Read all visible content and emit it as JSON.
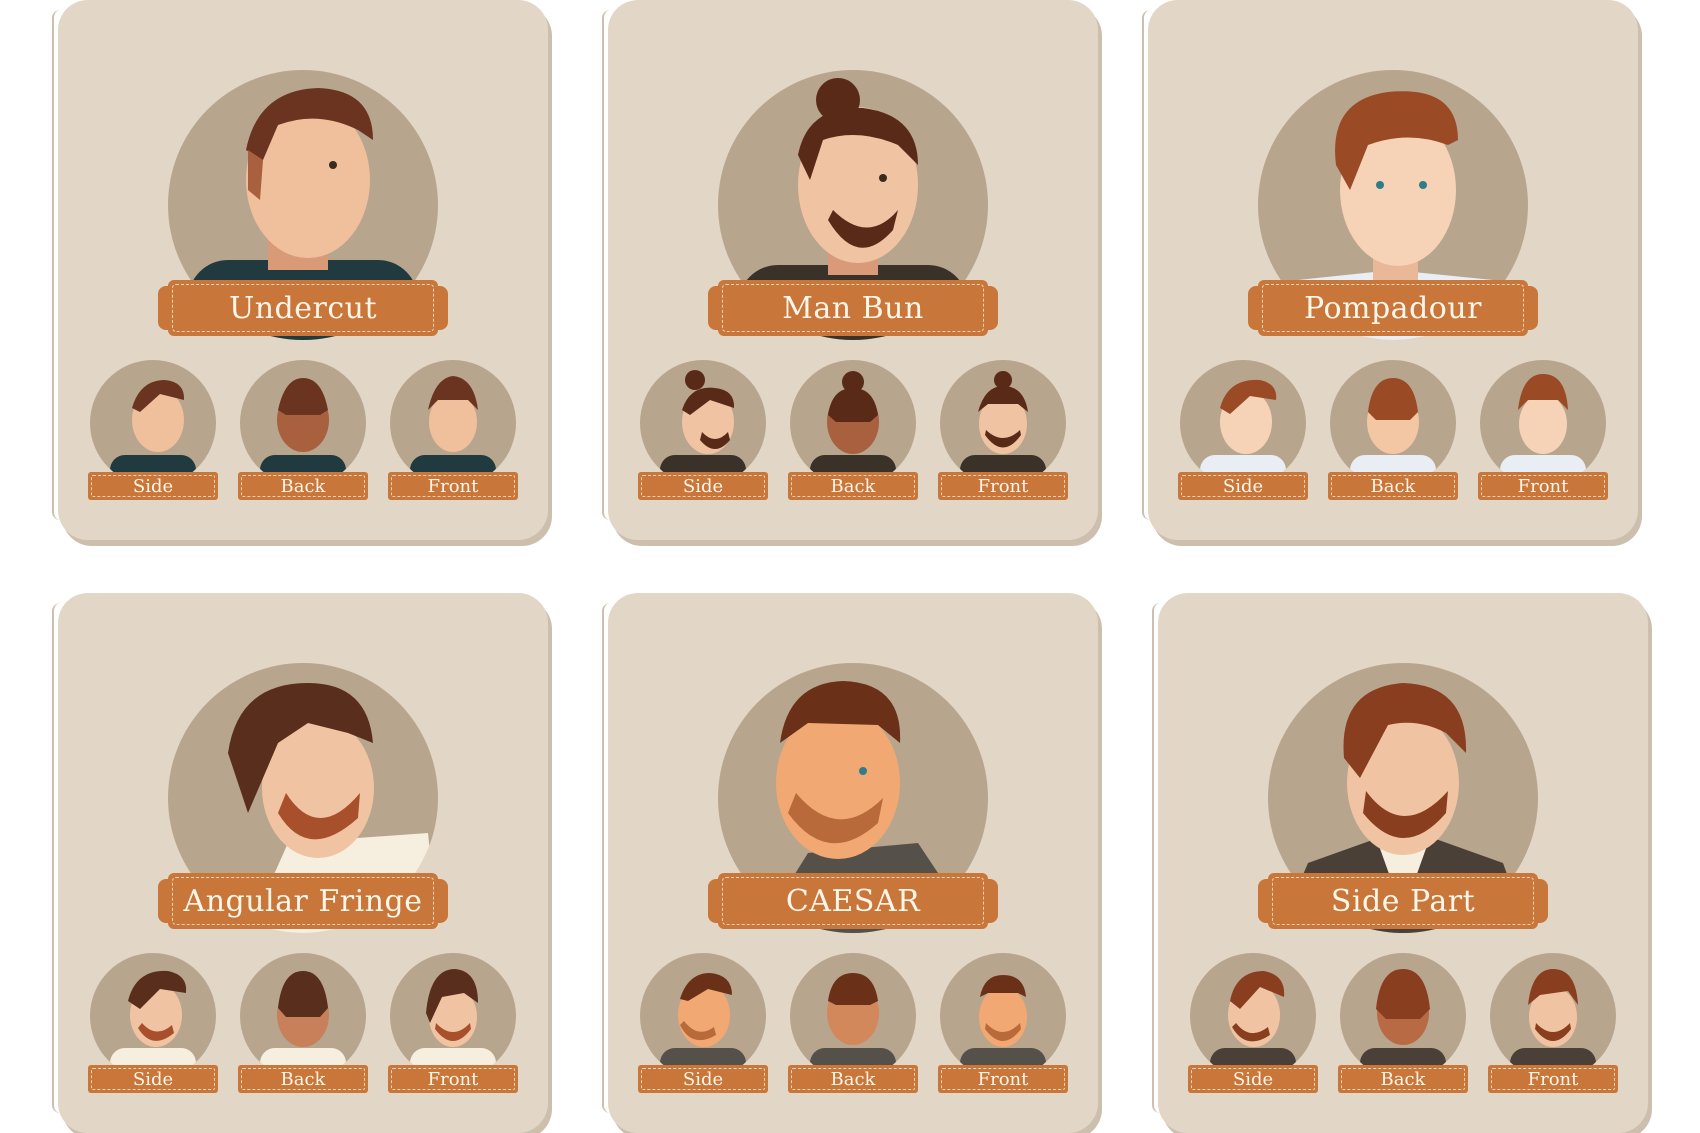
{
  "palette": {
    "card": "#e2d6c6",
    "circle": "#b8a58e",
    "banner": "#c87639",
    "banner_text": "#fff6ea"
  },
  "cards": [
    {
      "title": "Undercut",
      "views": [
        "Side",
        "Back",
        "Front"
      ],
      "hair": "#6a3420",
      "shirt": "#203a3f",
      "skin": "#f0bf9c"
    },
    {
      "title": "Man Bun",
      "views": [
        "Side",
        "Back",
        "Front"
      ],
      "hair": "#5a2a18",
      "shirt": "#3a3128",
      "skin": "#f0c4a2"
    },
    {
      "title": "Pompadour",
      "views": [
        "Side",
        "Back",
        "Front"
      ],
      "hair": "#9a4a24",
      "shirt": "#e8eef4",
      "skin": "#f6d2b6"
    },
    {
      "title": "Angular Fringe",
      "views": [
        "Side",
        "Back",
        "Front"
      ],
      "hair": "#5a2e1c",
      "shirt": "#f6efe0",
      "skin": "#f0c4a2"
    },
    {
      "title": "CAESAR",
      "views": [
        "Side",
        "Back",
        "Front"
      ],
      "hair": "#6a3018",
      "shirt": "#55504a",
      "skin": "#f2a872"
    },
    {
      "title": "Side Part",
      "views": [
        "Side",
        "Back",
        "Front"
      ],
      "hair": "#8a3e20",
      "shirt": "#4a4038",
      "skin": "#f0c4a2"
    }
  ]
}
